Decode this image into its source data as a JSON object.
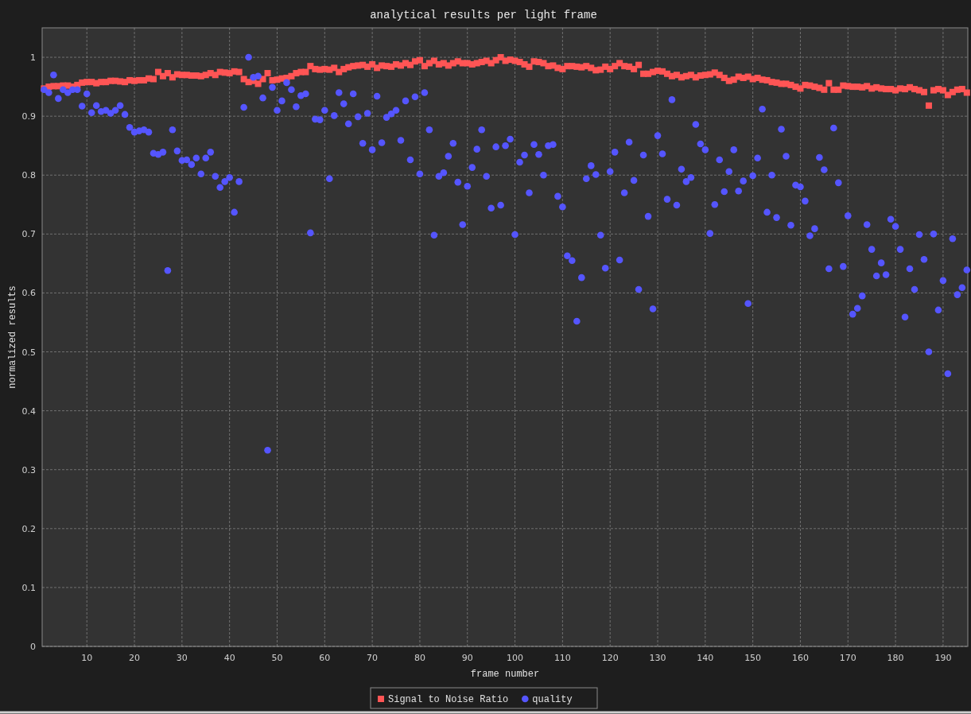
{
  "chart": {
    "chart_data": {
      "type": "scatter",
      "title": "analytical results per light frame",
      "xlabel": "frame number",
      "ylabel": "normalized results",
      "grid": true,
      "legend": true,
      "x": [
        1,
        2,
        3,
        4,
        5,
        6,
        7,
        8,
        9,
        10,
        11,
        12,
        13,
        14,
        15,
        16,
        17,
        18,
        19,
        20,
        21,
        22,
        23,
        24,
        25,
        26,
        27,
        28,
        29,
        30,
        31,
        32,
        33,
        34,
        35,
        36,
        37,
        38,
        39,
        40,
        41,
        42,
        43,
        44,
        45,
        46,
        47,
        48,
        49,
        50,
        51,
        52,
        53,
        54,
        55,
        56,
        57,
        58,
        59,
        60,
        61,
        62,
        63,
        64,
        65,
        66,
        67,
        68,
        69,
        70,
        71,
        72,
        73,
        74,
        75,
        76,
        77,
        78,
        79,
        80,
        81,
        82,
        83,
        84,
        85,
        86,
        87,
        88,
        89,
        90,
        91,
        92,
        93,
        94,
        95,
        96,
        97,
        98,
        99,
        100,
        101,
        102,
        103,
        104,
        105,
        106,
        107,
        108,
        109,
        110,
        111,
        112,
        113,
        114,
        115,
        116,
        117,
        118,
        119,
        120,
        121,
        122,
        123,
        124,
        125,
        126,
        127,
        128,
        129,
        130,
        131,
        132,
        133,
        134,
        135,
        136,
        137,
        138,
        139,
        140,
        141,
        142,
        143,
        144,
        145,
        146,
        147,
        148,
        149,
        150,
        151,
        152,
        153,
        154,
        155,
        156,
        157,
        158,
        159,
        160,
        161,
        162,
        163,
        164,
        165,
        166,
        167,
        168,
        169,
        170,
        171,
        172,
        173,
        174,
        175,
        176,
        177,
        178,
        179,
        180,
        181,
        182,
        183,
        184,
        185,
        186,
        187,
        188,
        189,
        190,
        191,
        192,
        193,
        194,
        195
      ],
      "xlim": [
        0.6,
        195.2
      ],
      "ylim": [
        0,
        1.05
      ],
      "xticks": [
        10,
        20,
        30,
        40,
        50,
        60,
        70,
        80,
        90,
        100,
        110,
        120,
        130,
        140,
        150,
        160,
        170,
        180,
        190
      ],
      "yticks": [
        {
          "value": 0,
          "label": "0"
        },
        {
          "value": 0.1,
          "label": "0.1"
        },
        {
          "value": 0.2,
          "label": "0.2"
        },
        {
          "value": 0.3,
          "label": "0.3"
        },
        {
          "value": 0.4,
          "label": "0.4"
        },
        {
          "value": 0.5,
          "label": "0.5"
        },
        {
          "value": 0.6,
          "label": "0.6"
        },
        {
          "value": 0.7,
          "label": "0.7"
        },
        {
          "value": 0.8,
          "label": "0.8"
        },
        {
          "value": 0.9,
          "label": "0.9"
        },
        {
          "value": 1,
          "label": "1"
        }
      ],
      "series": [
        {
          "name": "Signal to Noise Ratio",
          "color": "#ff5555",
          "marker": "square",
          "values": [
            0.947,
            0.95,
            0.951,
            0.951,
            0.952,
            0.952,
            0.95,
            0.953,
            0.957,
            0.958,
            0.958,
            0.956,
            0.958,
            0.958,
            0.96,
            0.96,
            0.959,
            0.958,
            0.961,
            0.96,
            0.961,
            0.961,
            0.964,
            0.963,
            0.975,
            0.968,
            0.973,
            0.966,
            0.971,
            0.97,
            0.97,
            0.969,
            0.969,
            0.968,
            0.97,
            0.973,
            0.97,
            0.975,
            0.974,
            0.973,
            0.976,
            0.975,
            0.963,
            0.958,
            0.96,
            0.955,
            0.963,
            0.973,
            0.961,
            0.962,
            0.964,
            0.965,
            0.968,
            0.973,
            0.975,
            0.975,
            0.985,
            0.98,
            0.979,
            0.98,
            0.979,
            0.982,
            0.975,
            0.98,
            0.983,
            0.985,
            0.986,
            0.987,
            0.984,
            0.988,
            0.982,
            0.986,
            0.985,
            0.984,
            0.988,
            0.986,
            0.99,
            0.987,
            0.993,
            0.995,
            0.985,
            0.99,
            0.994,
            0.988,
            0.99,
            0.986,
            0.99,
            0.993,
            0.99,
            0.99,
            0.988,
            0.99,
            0.992,
            0.994,
            0.99,
            0.995,
            1.0,
            0.994,
            0.996,
            0.994,
            0.992,
            0.988,
            0.984,
            0.993,
            0.992,
            0.99,
            0.985,
            0.986,
            0.982,
            0.98,
            0.985,
            0.985,
            0.984,
            0.983,
            0.985,
            0.982,
            0.978,
            0.979,
            0.984,
            0.98,
            0.985,
            0.99,
            0.985,
            0.984,
            0.98,
            0.987,
            0.972,
            0.972,
            0.975,
            0.977,
            0.976,
            0.972,
            0.968,
            0.97,
            0.966,
            0.968,
            0.97,
            0.966,
            0.969,
            0.97,
            0.971,
            0.974,
            0.97,
            0.965,
            0.96,
            0.962,
            0.967,
            0.965,
            0.967,
            0.963,
            0.965,
            0.962,
            0.961,
            0.958,
            0.957,
            0.955,
            0.955,
            0.953,
            0.95,
            0.947,
            0.953,
            0.952,
            0.95,
            0.948,
            0.945,
            0.956,
            0.945,
            0.945,
            0.952,
            0.951,
            0.95,
            0.95,
            0.949,
            0.951,
            0.947,
            0.949,
            0.947,
            0.946,
            0.946,
            0.944,
            0.947,
            0.946,
            0.949,
            0.946,
            0.944,
            0.941,
            0.918,
            0.944,
            0.946,
            0.944,
            0.936,
            0.941,
            0.945,
            0.946,
            0.94
          ]
        },
        {
          "name": "quality",
          "color": "#5555ff",
          "marker": "circle",
          "values": [
            0.945,
            0.94,
            0.97,
            0.93,
            0.945,
            0.94,
            0.945,
            0.945,
            0.917,
            0.938,
            0.906,
            0.918,
            0.908,
            0.91,
            0.905,
            0.91,
            0.918,
            0.903,
            0.881,
            0.873,
            0.875,
            0.877,
            0.873,
            0.837,
            0.835,
            0.839,
            0.638,
            0.877,
            0.841,
            0.825,
            0.826,
            0.818,
            0.829,
            0.802,
            0.829,
            0.839,
            0.798,
            0.779,
            0.789,
            0.796,
            0.737,
            0.789,
            0.915,
            1.0,
            0.966,
            0.968,
            0.931,
            0.333,
            0.949,
            0.91,
            0.926,
            0.957,
            0.945,
            0.916,
            0.935,
            0.938,
            0.702,
            0.895,
            0.894,
            0.91,
            0.794,
            0.901,
            0.94,
            0.921,
            0.887,
            0.938,
            0.899,
            0.854,
            0.905,
            0.843,
            0.934,
            0.855,
            0.898,
            0.904,
            0.91,
            0.859,
            0.926,
            0.826,
            0.933,
            0.802,
            0.94,
            0.877,
            0.698,
            0.798,
            0.804,
            0.832,
            0.854,
            0.788,
            0.716,
            0.781,
            0.813,
            0.844,
            0.877,
            0.798,
            0.744,
            0.848,
            0.749,
            0.85,
            0.861,
            0.699,
            0.822,
            0.834,
            0.77,
            0.852,
            0.835,
            0.8,
            0.85,
            0.852,
            0.764,
            0.746,
            0.663,
            0.655,
            0.552,
            0.626,
            0.794,
            0.816,
            0.801,
            0.698,
            0.642,
            0.806,
            0.839,
            0.656,
            0.77,
            0.856,
            0.791,
            0.606,
            0.834,
            0.73,
            0.573,
            0.867,
            0.836,
            0.759,
            0.928,
            0.749,
            0.81,
            0.789,
            0.796,
            0.886,
            0.853,
            0.843,
            0.701,
            0.75,
            0.826,
            0.772,
            0.806,
            0.843,
            0.773,
            0.79,
            0.582,
            0.799,
            0.829,
            0.912,
            0.737,
            0.8,
            0.728,
            0.878,
            0.832,
            0.715,
            0.783,
            0.78,
            0.756,
            0.697,
            0.709,
            0.83,
            0.809,
            0.641,
            0.88,
            0.787,
            0.645,
            0.731,
            0.564,
            0.574,
            0.595,
            0.716,
            0.674,
            0.629,
            0.651,
            0.631,
            0.725,
            0.713,
            0.674,
            0.559,
            0.641,
            0.606,
            0.699,
            0.657,
            0.5,
            0.7,
            0.571,
            0.621,
            0.463,
            0.692,
            0.597,
            0.609,
            0.639
          ]
        }
      ]
    }
  }
}
